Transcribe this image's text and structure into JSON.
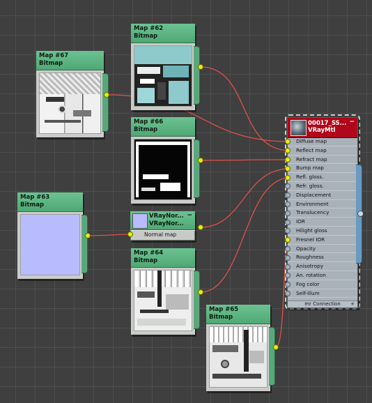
{
  "nodes": {
    "map67": {
      "name": "Map #67",
      "type": "Bitmap"
    },
    "map62": {
      "name": "Map #62",
      "type": "Bitmap"
    },
    "map66": {
      "name": "Map #66",
      "type": "Bitmap"
    },
    "map63": {
      "name": "Map #63",
      "type": "Bitmap"
    },
    "map64": {
      "name": "Map #64",
      "type": "Bitmap"
    },
    "map65": {
      "name": "Map #65",
      "type": "Bitmap"
    },
    "vraynormal": {
      "title1": "VRayNor...",
      "title2": "VRayNor...",
      "slot": "Normal map",
      "swatch_color": "#b9bbff"
    }
  },
  "material": {
    "title": "00017_SS...",
    "subtitle": "VRayMtl",
    "header_color": "#b0071a",
    "slots": [
      {
        "label": "Diffuse map",
        "connected": true
      },
      {
        "label": "Reflect map",
        "connected": true
      },
      {
        "label": "Refract map",
        "connected": true
      },
      {
        "label": "Bump map",
        "connected": true
      },
      {
        "label": "Refl. gloss.",
        "connected": true
      },
      {
        "label": "Refr. gloss.",
        "connected": false
      },
      {
        "label": "Displacement",
        "connected": false
      },
      {
        "label": "Environment",
        "connected": false
      },
      {
        "label": "Translucency",
        "connected": false
      },
      {
        "label": "IOR",
        "connected": false
      },
      {
        "label": "Hilight gloss",
        "connected": false
      },
      {
        "label": "Fresnel IOR",
        "connected": true
      },
      {
        "label": "Opacity",
        "connected": false
      },
      {
        "label": "Roughness",
        "connected": false
      },
      {
        "label": "Anisotropy",
        "connected": false
      },
      {
        "label": "An. rotation",
        "connected": false
      },
      {
        "label": "Fog color",
        "connected": false
      },
      {
        "label": "Self-illum",
        "connected": false
      }
    ],
    "footer": "mr Connection"
  },
  "wire_color": "#e0504a",
  "socket_color": "#e6ee10"
}
